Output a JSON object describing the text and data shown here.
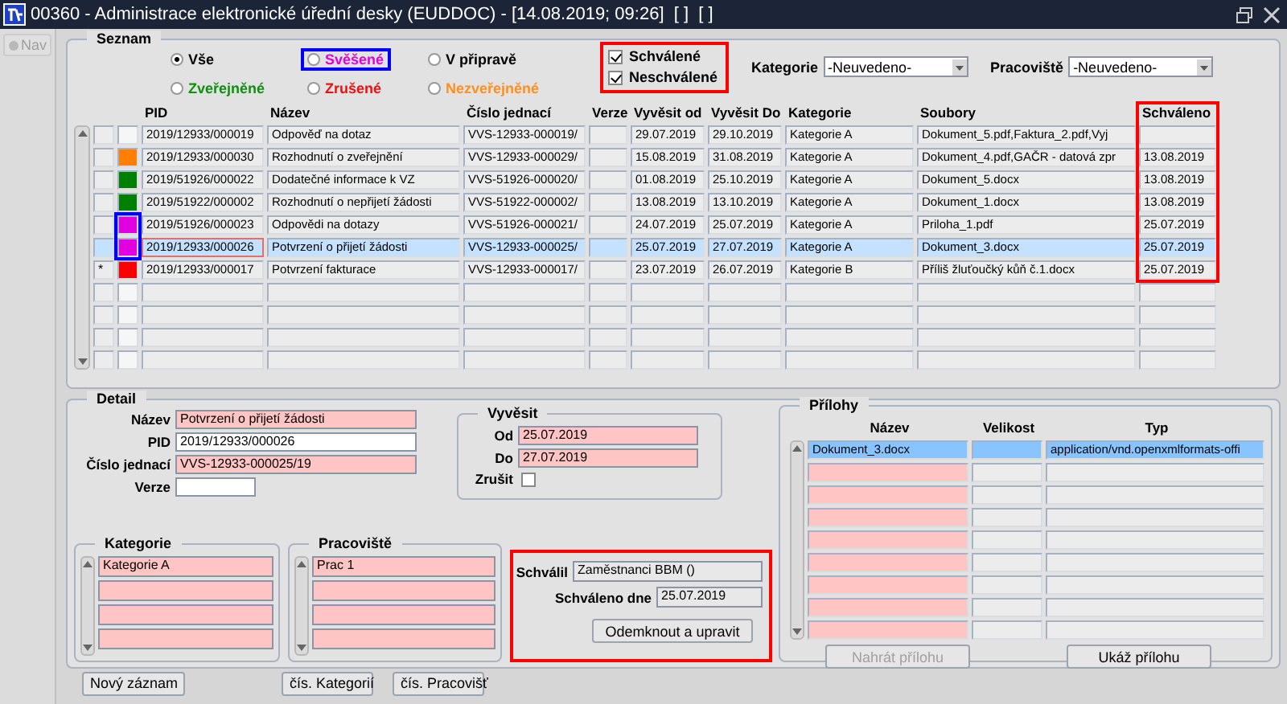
{
  "window": {
    "title": "00360 - Administrace elektronické úřední desky (EUDDOC) - [14.08.2019; 09:26]  [ ]  [ ]"
  },
  "nav_button": {
    "label": "Nav",
    "disabled": true
  },
  "seznam": {
    "title": "Seznam",
    "radios": [
      {
        "label": "Vše",
        "selected": true,
        "color": "#000000"
      },
      {
        "label": "Svěšené",
        "selected": false,
        "color": "#e000e0",
        "frame": {
          "color": "#0000ff"
        }
      },
      {
        "label": "V připravě",
        "selected": false,
        "color": "#000000"
      },
      {
        "label": "Zveřejněné",
        "selected": false,
        "color": "#109010"
      },
      {
        "label": "Zrušené",
        "selected": false,
        "color": "#f01010"
      },
      {
        "label": "Nezveřejněné",
        "selected": false,
        "color": "#ff9020"
      }
    ],
    "approval_filter": {
      "frame": {
        "color": "#ff0000"
      },
      "items": [
        {
          "label": "Schválené",
          "checked": true
        },
        {
          "label": "Neschválené",
          "checked": true
        }
      ]
    },
    "filters": [
      {
        "label": "Kategorie",
        "value": "-Neuvedeno-"
      },
      {
        "label": "Pracoviště",
        "value": "-Neuvedeno-"
      }
    ],
    "table": {
      "columns": [
        {
          "label": "PID"
        },
        {
          "label": "Název"
        },
        {
          "label": "Číslo jednací"
        },
        {
          "label": "Verze"
        },
        {
          "label": "Vyvěsit od"
        },
        {
          "label": "Vyvěsit Do"
        },
        {
          "label": "Kategorie"
        },
        {
          "label": "Soubory"
        },
        {
          "label": "Schváleno",
          "frame": {
            "color": "#ff0000"
          }
        }
      ],
      "rows": [
        {
          "selected": false,
          "cells": [
            "2019/12933/000019",
            "Odpověď na dotaz",
            "VVS-12933-000019/",
            "",
            "29.07.2019",
            "29.10.2019",
            "Kategorie A",
            "Dokument_5.pdf,Faktura_2.pdf,Vyj",
            ""
          ]
        },
        {
          "selected": false,
          "color": "#ff8000",
          "cells": [
            "2019/12933/000030",
            "Rozhodnutí o zveřejnění",
            "VVS-12933-000029/",
            "",
            "15.08.2019",
            "31.08.2019",
            "Kategorie A",
            "Dokument_4.pdf,GAČR - datová zpr",
            "13.08.2019"
          ]
        },
        {
          "selected": false,
          "color": "#008000",
          "cells": [
            "2019/51926/000022",
            "Dodatečné informace k VZ",
            "VVS-51926-000020/",
            "",
            "01.08.2019",
            "25.10.2019",
            "Kategorie A",
            "Dokument_5.docx",
            "13.08.2019"
          ]
        },
        {
          "selected": false,
          "color": "#008000",
          "cells": [
            "2019/51922/000002",
            "Rozhodnutí o nepřijetí žádosti",
            "VVS-51922-000002/",
            "",
            "13.08.2019",
            "13.10.2019",
            "Kategorie A",
            "Dokument_1.docx",
            "13.08.2019"
          ]
        },
        {
          "selected": false,
          "color": "#e000e0",
          "frame": {
            "color": "#0000ff"
          },
          "cells": [
            "2019/51926/000023",
            "Odpovědi na dotazy",
            "VVS-51926-000021/",
            "",
            "24.07.2019",
            "25.07.2019",
            "Kategorie A",
            "Priloha_1.pdf",
            "25.07.2019"
          ]
        },
        {
          "selected": true,
          "color": "#e000e0",
          "frame": {
            "color": "#0000ff"
          },
          "cells": [
            "2019/12933/000026",
            "Potvrzení o přijetí žádosti",
            "VVS-12933-000025/",
            "",
            "25.07.2019",
            "27.07.2019",
            "Kategorie A",
            "Dokument_3.docx",
            "25.07.2019"
          ]
        },
        {
          "selected": false,
          "color": "#ff0000",
          "marker": "*",
          "cells": [
            "2019/12933/000017",
            "Potvrzení fakturace",
            "VVS-12933-000017/",
            "",
            "23.07.2019",
            "26.07.2019",
            "Kategorie B",
            "Příliš žluťoučký kůň č.1.docx",
            "25.07.2019"
          ]
        }
      ]
    }
  },
  "detail": {
    "title": "Detail",
    "fields": [
      {
        "label": "Název",
        "value": "Potvrzení o přijetí žádosti",
        "required": true
      },
      {
        "label": "PID",
        "value": "2019/12933/000026",
        "required": false
      },
      {
        "label": "Číslo jednací",
        "value": "VVS-12933-000025/19",
        "required": true
      },
      {
        "label": "Verze",
        "required": false
      }
    ],
    "vyvesit": {
      "title": "Vyvěsit",
      "fields": [
        {
          "label": "Od",
          "value": "25.07.2019"
        },
        {
          "label": "Do",
          "value": "27.07.2019"
        }
      ],
      "cancel": {
        "label": "Zrušit",
        "checked": false
      }
    },
    "kategorie": {
      "title": "Kategorie",
      "items": [
        "Kategorie A"
      ]
    },
    "pracoviste": {
      "title": "Pracoviště",
      "items": [
        "Prac 1"
      ]
    },
    "approval": {
      "frame": {
        "color": "#ff0000"
      },
      "approver": {
        "label": "Schválil",
        "value": "Zaměstnanci BBM  ()"
      },
      "date": {
        "label": "Schváleno dne",
        "value": "25.07.2019"
      },
      "button": "Odemknout a upravit"
    },
    "prilohy": {
      "title": "Přílohy",
      "columns": [
        "Název",
        "Velikost",
        "Typ"
      ],
      "rows": [
        {
          "name": "Dokument_3.docx",
          "type": "application/vnd.openxmlformats-offi",
          "selected": true
        }
      ],
      "buttons": [
        {
          "label": "Nahrát přílohu",
          "disabled": true
        },
        {
          "label": "Ukáž přílohu",
          "disabled": false
        }
      ]
    }
  },
  "buttons": [
    "Nový záznam",
    "čís. Kategorií",
    "čís. Pracovišť"
  ]
}
